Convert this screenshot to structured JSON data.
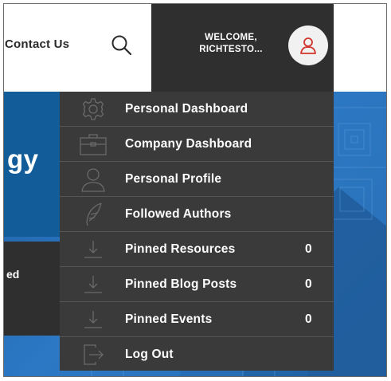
{
  "header": {
    "contact_label": "Contact Us",
    "welcome_line1": "WELCOME,",
    "welcome_line2": "RICHTESTO...",
    "search_icon": "search-icon",
    "avatar_icon": "user-icon"
  },
  "hero": {
    "title_fragment": "gy",
    "text_fragment": "ed"
  },
  "menu": {
    "items": [
      {
        "label": "Personal Dashboard",
        "icon": "gear-icon",
        "count": ""
      },
      {
        "label": "Company Dashboard",
        "icon": "briefcase-icon",
        "count": ""
      },
      {
        "label": "Personal Profile",
        "icon": "person-icon",
        "count": ""
      },
      {
        "label": "Followed Authors",
        "icon": "feather-icon",
        "count": ""
      },
      {
        "label": "Pinned Resources",
        "icon": "download-icon",
        "count": "0"
      },
      {
        "label": "Pinned Blog Posts",
        "icon": "download-icon",
        "count": "0"
      },
      {
        "label": "Pinned Events",
        "icon": "download-icon",
        "count": "0"
      },
      {
        "label": "Log Out",
        "icon": "logout-icon",
        "count": ""
      }
    ]
  },
  "colors": {
    "menu_bg": "#3a3a3a",
    "header_dark": "#2f2f2f",
    "accent_red": "#d0342c",
    "hero_blue": "#2c78c4"
  }
}
